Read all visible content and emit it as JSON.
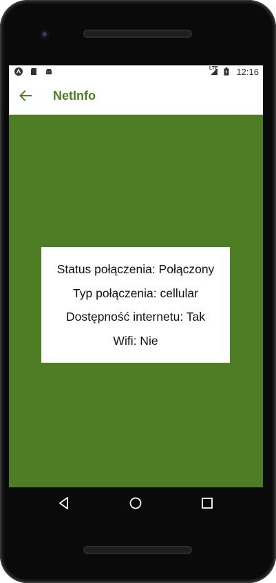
{
  "status_bar": {
    "time": "12:16",
    "network_label": "LTE",
    "left_icons": [
      "app-a-icon",
      "sd-card-icon",
      "android-icon"
    ],
    "right_icons": [
      "signal-icon",
      "battery-charging-icon"
    ]
  },
  "app_bar": {
    "title": "NetInfo",
    "back_icon": "arrow-back-icon"
  },
  "netinfo": {
    "status": "Status połączenia: Połączony",
    "type": "Typ połączenia: cellular",
    "internet": "Dostępność internetu: Tak",
    "wifi": "Wifi: Nie"
  },
  "nav_bar": {
    "icons": [
      "back-triangle-icon",
      "home-circle-icon",
      "recents-square-icon"
    ]
  },
  "colors": {
    "accent": "#4e7d26",
    "card": "#ffffff",
    "bezel": "#0a0a0a"
  }
}
